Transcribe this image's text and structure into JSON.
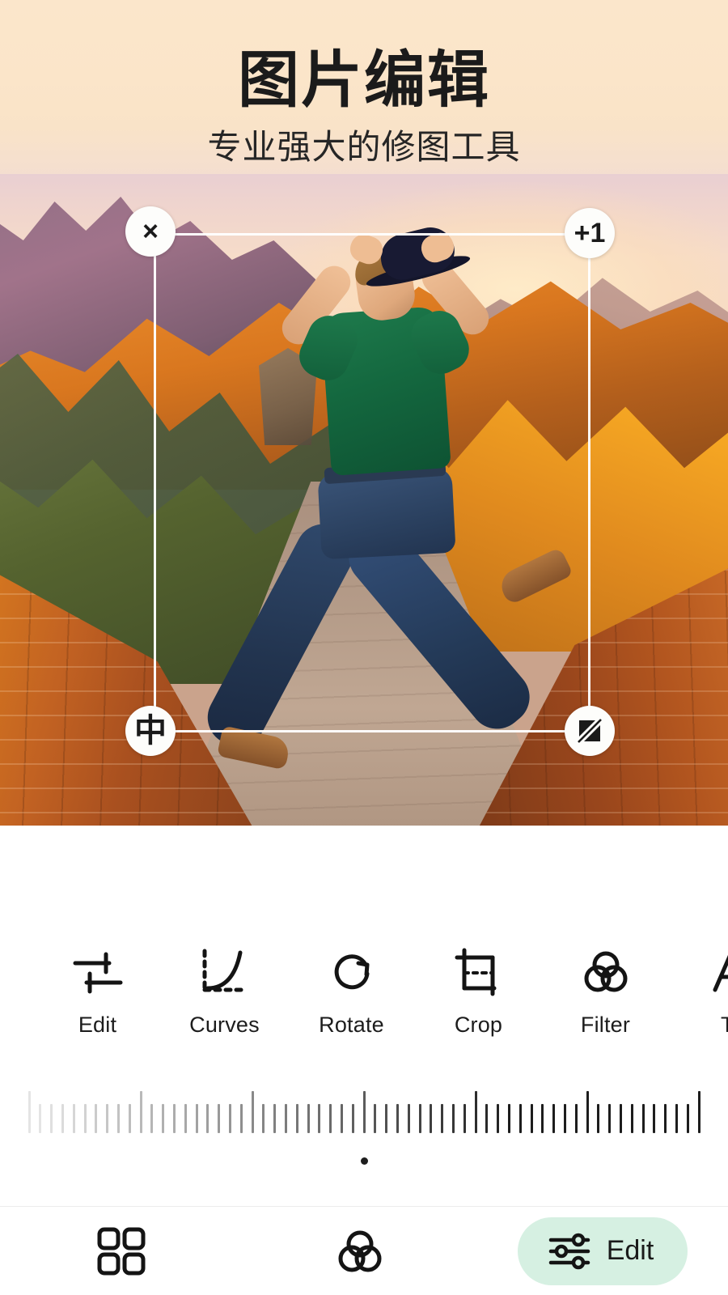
{
  "header": {
    "title": "图片编辑",
    "subtitle": "专业强大的修图工具"
  },
  "photo": {
    "alt": "man jumping on the Great Wall of China at sunset",
    "crop_handles": {
      "top_left": {
        "label": "×",
        "icon": "close-icon"
      },
      "top_right": {
        "label": "+1",
        "icon": "increment-icon"
      },
      "bottom_left": {
        "label": "中",
        "icon": "center-icon"
      },
      "bottom_right": {
        "label": "",
        "icon": "contrast-icon"
      }
    }
  },
  "toolbar": {
    "items": [
      {
        "label": "Edit",
        "icon": "sliders-icon"
      },
      {
        "label": "Curves",
        "icon": "curves-icon"
      },
      {
        "label": "Rotate",
        "icon": "rotate-cw-icon"
      },
      {
        "label": "Crop",
        "icon": "crop-icon"
      },
      {
        "label": "Filter",
        "icon": "filter-circles-icon"
      },
      {
        "label": "Te",
        "icon": "text-a-icon"
      }
    ]
  },
  "slider": {
    "name": "adjust-ruler",
    "value": 0,
    "min": -50,
    "max": 50,
    "tick_count": 61,
    "center_index": 30
  },
  "bottom_nav": {
    "items": [
      {
        "label": "",
        "icon": "grid-icon",
        "active": false
      },
      {
        "label": "",
        "icon": "filter-circles-icon",
        "active": false
      },
      {
        "label": "Edit",
        "icon": "sliders-alt-icon",
        "active": true
      }
    ],
    "active_pill_color": "#d6f0e2"
  },
  "colors": {
    "header_bg": "#fbe6cb",
    "accent_mint": "#d6f0e2",
    "ink": "#1a1a1a",
    "panel_bg": "#ffffff"
  }
}
